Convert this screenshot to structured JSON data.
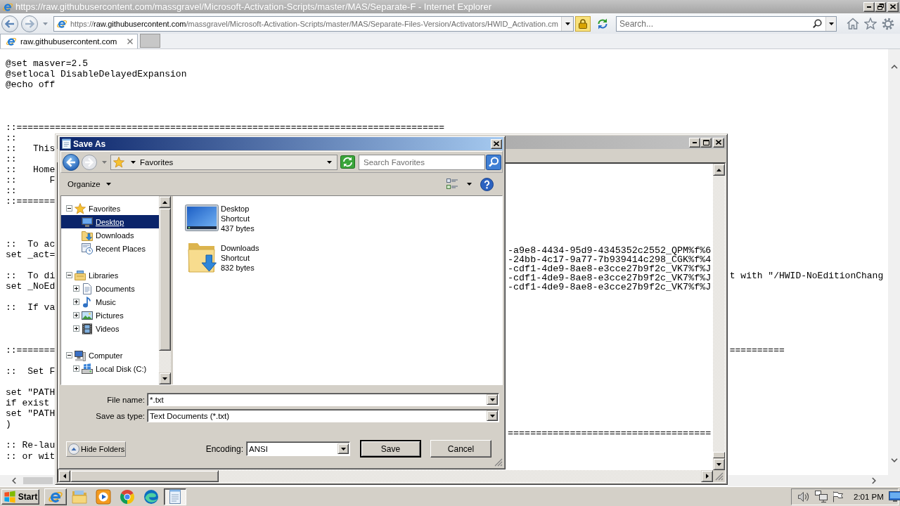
{
  "browser": {
    "title": "https://raw.githubusercontent.com/massgravel/Microsoft-Activation-Scripts/master/MAS/Separate-F - Internet Explorer",
    "address": {
      "scheme": "https://",
      "host": "raw.githubusercontent.com",
      "path": "/massgravel/Microsoft-Activation-Scripts/master/MAS/Separate-Files-Version/Activators/HWID_Activation.cm"
    },
    "search": {
      "placeholder": "Search..."
    },
    "tabs": [
      {
        "label": "raw.githubusercontent.com",
        "selected": true
      }
    ]
  },
  "page": {
    "blocks": [
      {
        "lines": [
          {
            "text": "@set masver=2.5"
          },
          {
            "text": "@setlocal DisableDelayedExpansion"
          },
          {
            "text": "@echo off"
          }
        ]
      },
      {
        "lines": [
          {
            "text": "::=============================================================================="
          },
          {
            "text": "::"
          },
          {
            "text": "::   This"
          },
          {
            "text": "::"
          },
          {
            "text": "::   Home"
          },
          {
            "text": "::      F"
          },
          {
            "text": "::"
          },
          {
            "text": "::======="
          }
        ]
      },
      {
        "lines": [
          {
            "text": "::  To ac"
          },
          {
            "text": "set _act="
          }
        ]
      },
      {
        "lines": [
          {
            "text": "::  To di",
            "right": "t with \"/HWID-NoEditionChang"
          },
          {
            "text": "set _NoEd"
          }
        ]
      },
      {
        "lines": [
          {
            "text": "::  If va"
          }
        ]
      },
      {
        "lines": [
          {
            "text": "::=======",
            "right": "=========="
          }
        ]
      },
      {
        "lines": [
          {
            "text": "::  Set F"
          }
        ]
      },
      {
        "lines": [
          {
            "text": "set \"PATH"
          },
          {
            "text": "if exist"
          },
          {
            "text": "set \"PATH"
          },
          {
            "text": ")"
          }
        ]
      },
      {
        "lines": [
          {
            "text": ":: Re-lau"
          },
          {
            "text": ":: or wit"
          }
        ]
      }
    ]
  },
  "notepad": {
    "blocks": [
      {
        "lines": [
          "-a9e8-4434-95d9-4345352c2552_QPM%f%6",
          "-24bb-4c17-9a77-7b939414c298_CGK%f%4",
          "-cdf1-4de9-8ae8-e3cce27b9f2c_VK7%f%J",
          "-cdf1-4de9-8ae8-e3cce27b9f2c_VK7%f%J",
          "-cdf1-4de9-8ae8-e3cce27b9f2c_VK7%f%J"
        ]
      },
      {
        "lines": [
          "===================================="
        ]
      }
    ]
  },
  "save_dialog": {
    "title": "Save As",
    "location": "Favorites",
    "search": {
      "placeholder": "Search Favorites"
    },
    "organize": "Organize",
    "tree": [
      {
        "label": "Favorites",
        "kind": "favorites",
        "expanded": true,
        "selected": false,
        "children": [
          {
            "label": "Desktop",
            "kind": "desktop",
            "selected": true
          },
          {
            "label": "Downloads",
            "kind": "downloads",
            "selected": false
          },
          {
            "label": "Recent Places",
            "kind": "recent",
            "selected": false
          }
        ]
      },
      {
        "label": "Libraries",
        "kind": "libraries",
        "expanded": true,
        "selected": false,
        "children": [
          {
            "label": "Documents",
            "kind": "documents",
            "expanded": false,
            "selected": false
          },
          {
            "label": "Music",
            "kind": "music",
            "expanded": false,
            "selected": false
          },
          {
            "label": "Pictures",
            "kind": "pictures",
            "expanded": false,
            "selected": false
          },
          {
            "label": "Videos",
            "kind": "videos",
            "expanded": false,
            "selected": false
          }
        ]
      },
      {
        "label": "Computer",
        "kind": "computer",
        "expanded": true,
        "selected": false,
        "children": [
          {
            "label": "Local Disk (C:)",
            "kind": "disk",
            "expanded": false,
            "selected": false
          }
        ]
      }
    ],
    "files": [
      {
        "name": "Desktop",
        "type": "Shortcut",
        "size": "437 bytes",
        "kind": "desktop",
        "selected": false
      },
      {
        "name": "Downloads",
        "type": "Shortcut",
        "size": "832 bytes",
        "kind": "downloads",
        "selected": false
      }
    ],
    "file_name": {
      "label": "File name:",
      "value": "*.txt"
    },
    "save_as_type": {
      "label": "Save as type:",
      "value": "Text Documents (*.txt)"
    },
    "hide_folders": "Hide Folders",
    "encoding": {
      "label": "Encoding:",
      "value": "ANSI"
    },
    "buttons": [
      {
        "label": "Save",
        "default": true
      },
      {
        "label": "Cancel",
        "default": false
      }
    ]
  },
  "taskbar": {
    "start": "Start",
    "apps": [
      {
        "kind": "ie",
        "running": true,
        "selected": false
      },
      {
        "kind": "explorer",
        "running": false,
        "selected": false
      },
      {
        "kind": "media",
        "running": false,
        "selected": false
      },
      {
        "kind": "chrome",
        "running": false,
        "selected": false
      },
      {
        "kind": "edge",
        "running": false,
        "selected": false
      },
      {
        "kind": "notepad",
        "running": true,
        "selected": true
      }
    ],
    "clock": "2:01 PM"
  }
}
